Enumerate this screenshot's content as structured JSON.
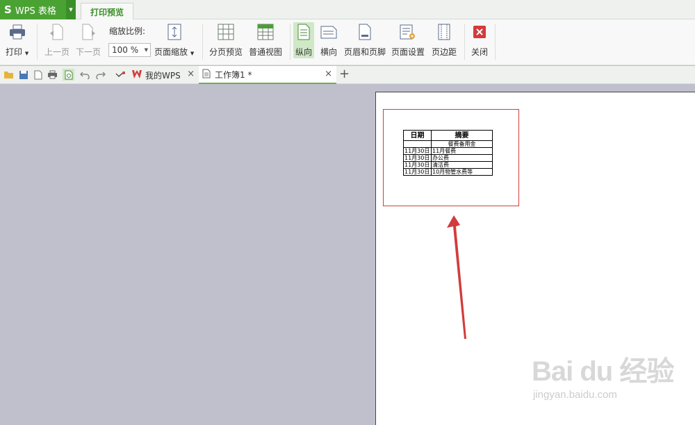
{
  "app": {
    "logo": "S",
    "name": "WPS 表格",
    "active_ribbon_tab": "打印预览"
  },
  "ribbon": {
    "print": "打印",
    "prev_page": "上一页",
    "next_page": "下一页",
    "zoom_label": "缩放比例:",
    "zoom_value": "100 %",
    "page_zoom": "页面缩放",
    "page_break_preview": "分页预览",
    "normal_view": "普通视图",
    "portrait": "纵向",
    "landscape": "横向",
    "header_footer": "页眉和页脚",
    "page_setup": "页面设置",
    "margins": "页边距",
    "close": "关闭"
  },
  "tabs": [
    {
      "label": "我的WPS"
    },
    {
      "label": "工作簿1 *"
    }
  ],
  "preview_table": {
    "headers": [
      "日期",
      "摘要"
    ],
    "rows": [
      [
        "",
        "餐费备用金"
      ],
      [
        "11月30日",
        "11月餐费"
      ],
      [
        "11月30日",
        "办公费"
      ],
      [
        "11月30日",
        "清洁费"
      ],
      [
        "11月30日",
        "10月物管水费等"
      ]
    ]
  },
  "watermark": {
    "brand": "Bai du 经验",
    "url": "jingyan.baidu.com"
  },
  "colors": {
    "brand_green": "#4aa233",
    "highlight": "#cfe8c6",
    "annotation_red": "#d23c3c"
  }
}
